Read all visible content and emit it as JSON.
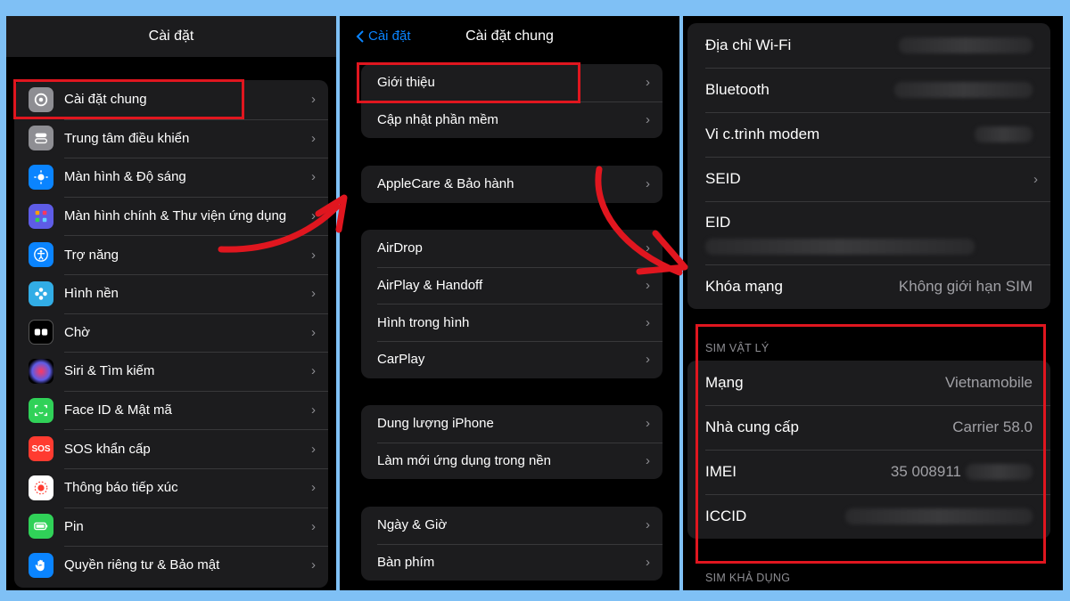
{
  "panel_general": {
    "title": "Cài đặt",
    "items": [
      {
        "label": "Cài đặt chung",
        "icon": "gear-icon",
        "color": "#8e8e93"
      },
      {
        "label": "Trung tâm điều khiển",
        "icon": "toggles-icon",
        "color": "#8e8e93"
      },
      {
        "label": "Màn hình & Độ sáng",
        "icon": "sun-icon",
        "color": "#0a84ff"
      },
      {
        "label": "Màn hình chính & Thư viện ứng dụng",
        "icon": "grid-icon",
        "color": "#5e5ce6"
      },
      {
        "label": "Trợ năng",
        "icon": "accessibility-icon",
        "color": "#0a84ff"
      },
      {
        "label": "Hình nền",
        "icon": "flower-icon",
        "color": "#32ade6"
      },
      {
        "label": "Chờ",
        "icon": "standby-icon",
        "color": "#1c1c1e"
      },
      {
        "label": "Siri & Tìm kiếm",
        "icon": "siri-icon",
        "color": "#222"
      },
      {
        "label": "Face ID & Mật mã",
        "icon": "faceid-icon",
        "color": "#30d158"
      },
      {
        "label": "SOS khẩn cấp",
        "icon": "sos-icon",
        "color": "#ff3b30",
        "glyph": "SOS"
      },
      {
        "label": "Thông báo tiếp xúc",
        "icon": "exposure-icon",
        "color": "#fff"
      },
      {
        "label": "Pin",
        "icon": "battery-icon",
        "color": "#30d158"
      },
      {
        "label": "Quyền riêng tư & Bảo mật",
        "icon": "hand-icon",
        "color": "#0a84ff"
      }
    ]
  },
  "panel_about_nav": {
    "back_label": "Cài đặt",
    "title": "Cài đặt chung",
    "groups": [
      [
        "Giới thiệu",
        "Cập nhật phần mềm"
      ],
      [
        "AppleCare & Bảo hành"
      ],
      [
        "AirDrop",
        "AirPlay & Handoff",
        "Hình trong hình",
        "CarPlay"
      ],
      [
        "Dung lượng iPhone",
        "Làm mới ứng dụng trong nền"
      ],
      [
        "Ngày & Giờ",
        "Bàn phím"
      ]
    ]
  },
  "panel_info": {
    "top_rows": [
      {
        "label": "Địa chỉ Wi-Fi",
        "value": ""
      },
      {
        "label": "Bluetooth",
        "value": ""
      },
      {
        "label": "Vi c.trình modem",
        "value": ""
      },
      {
        "label": "SEID",
        "value": ""
      },
      {
        "label": "EID",
        "value": ""
      },
      {
        "label": "Khóa mạng",
        "value": "Không giới hạn SIM"
      }
    ],
    "sim_section_label": "SIM VẬT LÝ",
    "sim_rows": [
      {
        "label": "Mạng",
        "value": "Vietnamobile"
      },
      {
        "label": "Nhà cung cấp",
        "value": "Carrier 58.0"
      },
      {
        "label": "IMEI",
        "value": "35 008911"
      },
      {
        "label": "ICCID",
        "value": ""
      }
    ],
    "available_section_label": "SIM KHẢ DỤNG"
  },
  "chevron": "›",
  "colors": {
    "highlight": "#e0161f",
    "background": "#7fc0f5"
  }
}
